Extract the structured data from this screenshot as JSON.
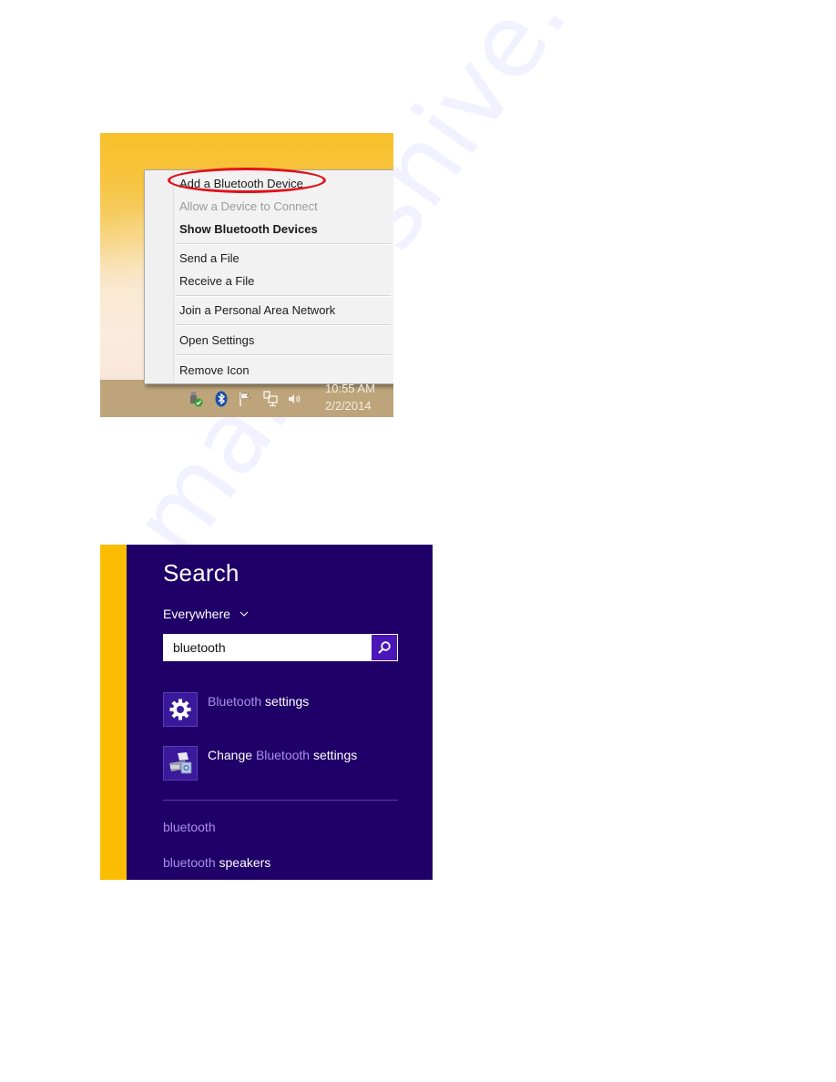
{
  "figure1": {
    "context_menu": {
      "items": [
        {
          "label": "Add a Bluetooth Device",
          "state": "enabled",
          "highlighted": true
        },
        {
          "label": "Allow a Device to Connect",
          "state": "disabled"
        },
        {
          "label": "Show Bluetooth Devices",
          "state": "default-bold"
        },
        {
          "label": "Send a File",
          "state": "enabled"
        },
        {
          "label": "Receive a File",
          "state": "enabled"
        },
        {
          "label": "Join a Personal Area Network",
          "state": "enabled"
        },
        {
          "label": "Open Settings",
          "state": "enabled"
        },
        {
          "label": "Remove Icon",
          "state": "enabled"
        }
      ],
      "highlight_color": "#e0121b"
    },
    "tray": {
      "icons": [
        "usb-safe-remove-icon",
        "bluetooth-icon",
        "action-center-flag-icon",
        "network-icon",
        "volume-icon"
      ],
      "time": "10:55 AM",
      "date": "2/2/2014"
    }
  },
  "figure2": {
    "title": "Search",
    "scope": "Everywhere",
    "query": "bluetooth",
    "results": [
      {
        "icon": "gear-icon",
        "highlight": "Bluetooth",
        "prefix": "",
        "suffix": " settings"
      },
      {
        "icon": "devices-printer-icon",
        "prefix": "Change ",
        "highlight": "Bluetooth",
        "suffix": " settings"
      }
    ],
    "suggestions": [
      {
        "highlight": "bluetooth",
        "suffix": ""
      },
      {
        "highlight": "bluetooth",
        "suffix": " speakers"
      }
    ],
    "colors": {
      "background": "#1f0068",
      "accent": "#fbbd02",
      "highlight_text": "#a990e8",
      "search_button": "#4a16b8"
    }
  },
  "watermark": "manualshive.com"
}
